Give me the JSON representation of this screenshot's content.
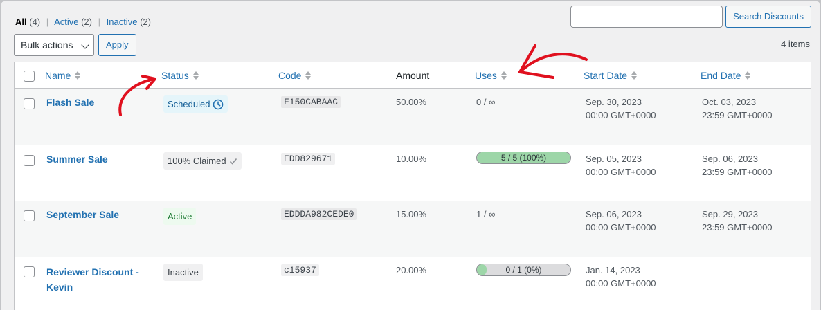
{
  "filters": {
    "all": {
      "label": "All",
      "count": "(4)"
    },
    "active": {
      "label": "Active",
      "count": "(2)"
    },
    "inactive": {
      "label": "Inactive",
      "count": "(2)"
    },
    "separator": "|"
  },
  "search": {
    "value": "",
    "placeholder": "",
    "button_label": "Search Discounts"
  },
  "bulk": {
    "label": "Bulk actions",
    "apply_label": "Apply"
  },
  "items_count": "4 items",
  "columns": {
    "name": "Name",
    "status": "Status",
    "code": "Code",
    "amount": "Amount",
    "uses": "Uses",
    "start_date": "Start Date",
    "end_date": "End Date"
  },
  "rows": [
    {
      "name": "Flash Sale",
      "name_line2": "",
      "status": "Scheduled",
      "code": "F150CABAAC",
      "amount": "50.00%",
      "uses_text": "0 / ∞",
      "uses_progress": null,
      "start_date": "Sep. 30, 2023",
      "start_time": "00:00 GMT+0000",
      "end_date": "Oct. 03, 2023",
      "end_time": "23:59 GMT+0000"
    },
    {
      "name": "Summer Sale",
      "name_line2": "",
      "status": "100% Claimed",
      "code": "EDD829671",
      "amount": "10.00%",
      "uses_text": "5 / 5 (100%)",
      "uses_progress": 1.0,
      "start_date": "Sep. 05, 2023",
      "start_time": "00:00 GMT+0000",
      "end_date": "Sep. 06, 2023",
      "end_time": "23:59 GMT+0000"
    },
    {
      "name": "September Sale",
      "name_line2": "",
      "status": "Active",
      "code": "EDDDA982CEDE0",
      "amount": "15.00%",
      "uses_text": "1 / ∞",
      "uses_progress": null,
      "start_date": "Sep. 06, 2023",
      "start_time": "00:00 GMT+0000",
      "end_date": "Sep. 29, 2023",
      "end_time": "23:59 GMT+0000"
    },
    {
      "name": "Reviewer Discount -",
      "name_line2": "Kevin",
      "status": "Inactive",
      "code": "c15937",
      "amount": "20.00%",
      "uses_text": "0 / 1 (0%)",
      "uses_progress": 0.0,
      "start_date": "Jan. 14, 2023",
      "start_time": "00:00 GMT+0000",
      "end_date": "—",
      "end_time": ""
    }
  ],
  "colors": {
    "link": "#2271b1",
    "annotation": "#e0101e",
    "progress_fill": "#9dd6a8",
    "scheduled_bg": "#e5f5fa",
    "active_bg": "#edfaef"
  }
}
